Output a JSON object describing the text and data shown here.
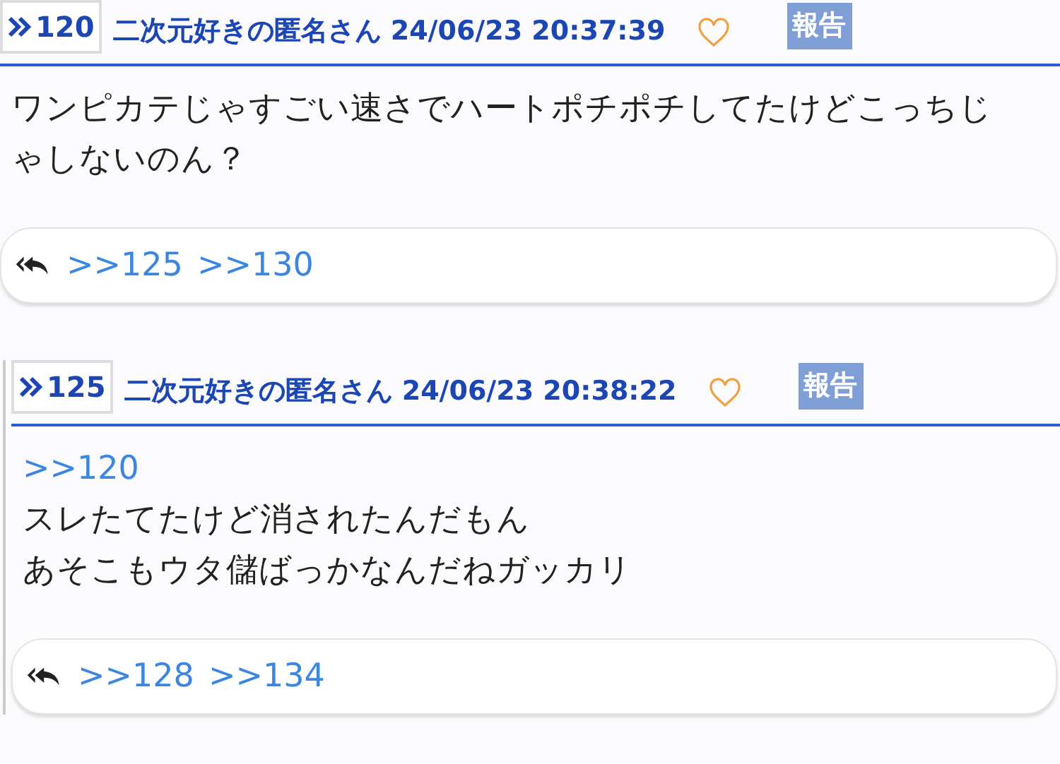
{
  "posts": [
    {
      "number": "120",
      "indented": false,
      "name": "二次元好きの匿名さん",
      "date": "24/06/23 20:37:39",
      "report": "報告",
      "body": [
        {
          "kind": "text",
          "text": "ワンピカテじゃすごい速さでハートポチポチしてたけどこっちじゃしないのん？"
        }
      ],
      "replies": [
        ">>125",
        ">>130"
      ]
    },
    {
      "number": "125",
      "indented": true,
      "name": "二次元好きの匿名さん",
      "date": "24/06/23 20:38:22",
      "report": "報告",
      "body": [
        {
          "kind": "anchor",
          "text": ">>120"
        },
        {
          "kind": "text",
          "text": "スレたてたけど消されたんだもん"
        },
        {
          "kind": "text",
          "text": "あそこもウタ儲ばっかなんだねガッカリ"
        }
      ],
      "replies": [
        ">>128",
        ">>134"
      ]
    }
  ]
}
